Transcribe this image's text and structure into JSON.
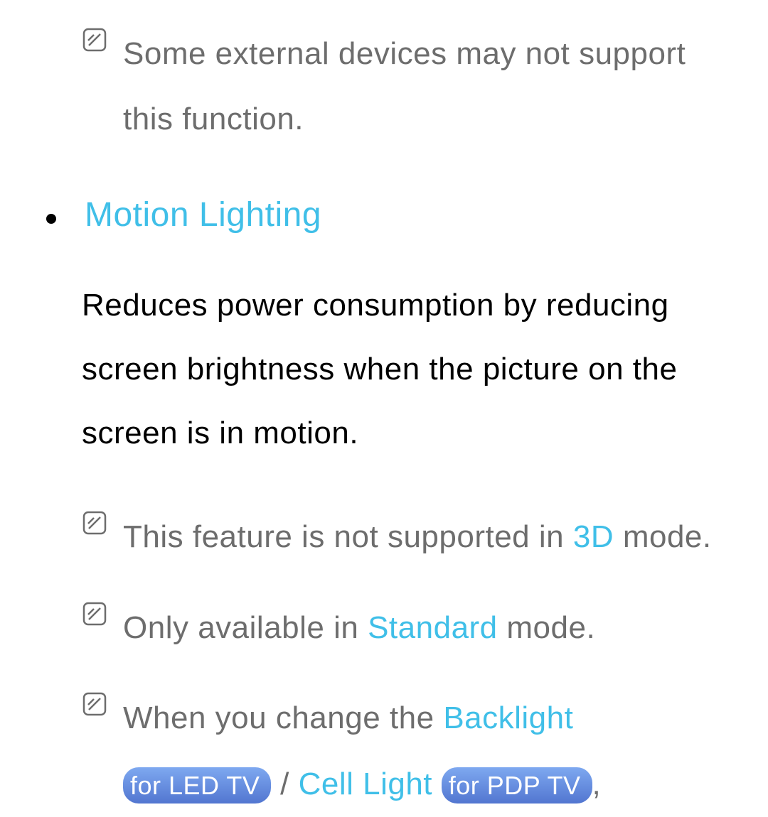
{
  "intro_note": "Some external devices may not support this function.",
  "section_title": "Motion Lighting",
  "body": "Reduces power consumption by reducing screen brightness when the picture on the screen is in motion.",
  "notes": {
    "n1": {
      "prefix": "This feature is not supported in ",
      "highlight": "3D",
      "suffix": " mode."
    },
    "n2": {
      "prefix": "Only available in ",
      "highlight": "Standard",
      "suffix": " mode."
    },
    "n3": {
      "prefix": "When you change the ",
      "h1": "Backlight",
      "badge1": "for LED TV",
      "sep": " / ",
      "h2": "Cell Light",
      "badge2": "for PDP TV",
      "tail": ","
    }
  }
}
